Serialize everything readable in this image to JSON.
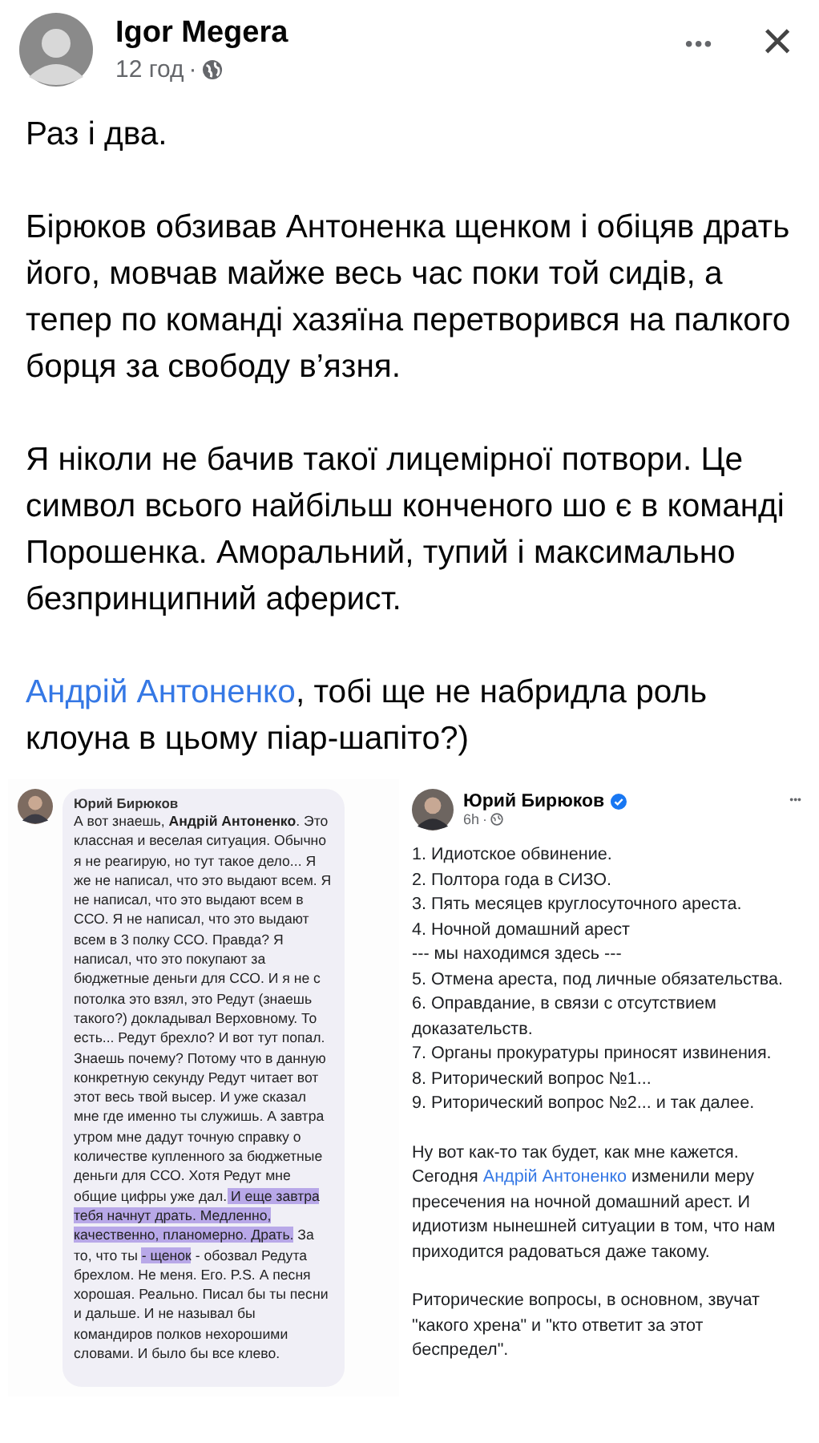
{
  "post": {
    "author": "Igor Megera",
    "time": "12 год",
    "separator": "·",
    "menu": "•••",
    "close": "×"
  },
  "paragraphs": [
    {
      "spans": [
        {
          "kind": "text",
          "text": "Раз і два."
        }
      ]
    },
    {
      "spans": [
        {
          "kind": "text",
          "text": "Бірюков обзивав Антоненка щенком і обіцяв драть його, мовчав майже весь час поки той сидів, а тепер по команді хазяїна перетворився на палкого борця за свободу в’язня."
        }
      ]
    },
    {
      "spans": [
        {
          "kind": "text",
          "text": "Я ніколи не бачив такої лицемірної потвори. Це символ всього найбільш конченого шо є в команді Порошенка. Аморальний, тупий і максимально безпринципний аферист."
        }
      ]
    },
    {
      "spans": [
        {
          "kind": "link",
          "text": "Андрій Антоненко"
        },
        {
          "kind": "text",
          "text": ", тобі ще не набридла роль клоуна в цьому піар-шапіто?)"
        }
      ]
    }
  ],
  "chat": {
    "sender": "Юрий Бирюков",
    "segments": [
      {
        "kind": "text",
        "text": "А вот знаешь, "
      },
      {
        "kind": "bold",
        "text": "Андрій Антоненко"
      },
      {
        "kind": "text",
        "text": ". Это классная и веселая ситуация. Обычно я не реагирую, но тут такое дело... Я же не написал, что это выдают всем. Я не написал, что это выдают всем в ССО. Я не написал, что это выдают всем в 3 полку ССО. Правда? Я написал, что это покупают за бюджетные деньги для ССО. И я не с потолка это взял, это Редут (знаешь такого?) докладывал Верховному. То есть... Редут брехло? И вот тут попал. Знаешь почему? Потому что в данную конкретную секунду Редут читает вот этот весь твой высер. И уже сказал мне где именно ты служишь. А завтра утром мне дадут точную справку о количестве купленного за бюджетные деньги для ССО. Хотя Редут мне общие цифры уже дал."
      },
      {
        "kind": "highlight",
        "text": " И еще завтра тебя начнут драть. Медленно, качественно, планомерно. Драть."
      },
      {
        "kind": "text",
        "text": " За то, что ты "
      },
      {
        "kind": "highlight",
        "text": "- щенок"
      },
      {
        "kind": "text",
        "text": " - обозвал Редута брехлом. Не меня. Его. P.S. А песня хорошая. Реально. Писал бы ты песни и дальше. И не называл бы командиров полков нехорошими словами. И было бы все клево."
      }
    ]
  },
  "quoted": {
    "author": "Юрий Бирюков",
    "verified": true,
    "time": "6h",
    "separator": "·",
    "menu": "•••",
    "lines": [
      "1. Идиотское обвинение.",
      "2. Полтора года в СИЗО.",
      "3. Пять месяцев круглосуточного ареста.",
      "4. Ночной домашний арест",
      "--- мы находимся здесь ---",
      "5. Отмена ареста, под личные обязательства.",
      "6. Оправдание, в связи с отсутствием доказательств.",
      "7. Органы прокуратуры приносят извинения.",
      "8. Риторический вопрос №1...",
      "9. Риторический вопрос №2... и так далее."
    ],
    "paragraphs": [
      {
        "spans": [
          {
            "kind": "text",
            "text": "Ну вот как-то так будет, как мне кажется. Сегодня "
          },
          {
            "kind": "link",
            "text": "Андрій Антоненко"
          },
          {
            "kind": "text",
            "text": " изменили меру пресечения на ночной домашний арест. И идиотизм нынешней ситуации в том, что нам приходится радоваться даже такому."
          }
        ]
      },
      {
        "spans": [
          {
            "kind": "text",
            "text": "Риторические вопросы, в основном, звучат \"какого хрена\" и \"кто ответит за этот беспредел\"."
          }
        ]
      }
    ]
  }
}
